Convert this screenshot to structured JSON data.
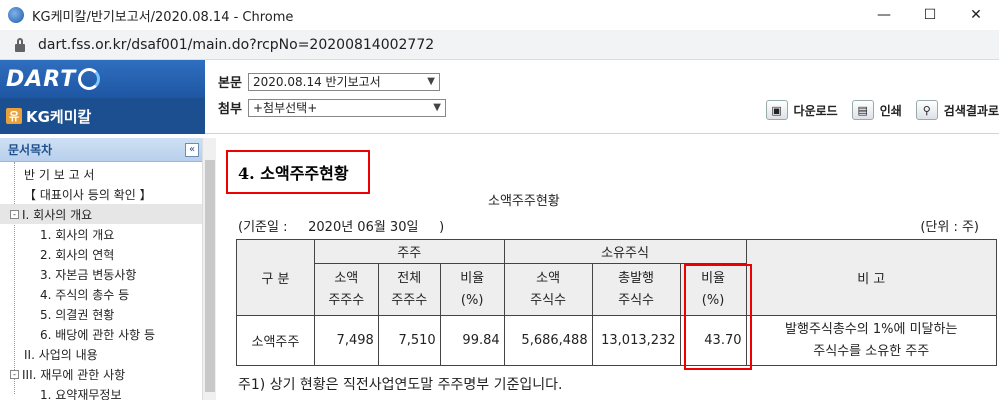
{
  "window": {
    "title": "KG케미칼/반기보고서/2020.08.14 - Chrome",
    "minimize": "—",
    "maximize": "☐",
    "close": "✕"
  },
  "address_bar": {
    "url": "dart.fss.or.kr/dsaf001/main.do?rcpNo=20200814002772"
  },
  "header": {
    "logo": "DART",
    "company": "KG케미칼",
    "company_badge": "유",
    "report_label": "본문",
    "report_value": "2020.08.14  반기보고서",
    "attach_label": "첨부",
    "attach_value": "+첨부선택+",
    "toolbar": {
      "download": "다운로드",
      "print": "인쇄",
      "search_results": "검색결과로"
    }
  },
  "sidebar": {
    "title": "문서목차",
    "collapse": "«",
    "items": [
      {
        "label": "반 기 보 고 서"
      },
      {
        "label": "【 대표이사 등의 확인 】"
      },
      {
        "label": "I. 회사의 개요",
        "expander": "-"
      },
      {
        "label": "1. 회사의 개요"
      },
      {
        "label": "2. 회사의 연혁"
      },
      {
        "label": "3. 자본금 변동사항"
      },
      {
        "label": "4. 주식의 총수 등"
      },
      {
        "label": "5. 의결권 현황"
      },
      {
        "label": "6. 배당에 관한 사항 등"
      },
      {
        "label": "II. 사업의 내용"
      },
      {
        "label": "III. 재무에 관한 사항",
        "expander": "-"
      },
      {
        "label": "1. 요약재무정보"
      }
    ]
  },
  "content": {
    "section_title": "4. 소액주주현황",
    "table_caption": "소액주주현황",
    "base_date": "(기준일 :     2020년 06월 30일     )",
    "unit": "(단위 : 주)",
    "table": {
      "col_gubun": "구 분",
      "group_shareholders": "주주",
      "group_shares": "소유주식",
      "col_note": "비 고",
      "sub_minor_holders": [
        "소액",
        "주주수"
      ],
      "sub_total_holders": [
        "전체",
        "주주수"
      ],
      "sub_ratio1": [
        "비율",
        "(%)"
      ],
      "sub_minor_shares": [
        "소액",
        "주식수"
      ],
      "sub_total_issued": [
        "총발행",
        "주식수"
      ],
      "sub_ratio2": [
        "비율",
        "(%)"
      ],
      "row": {
        "label": "소액주주",
        "minor_holders": "7,498",
        "total_holders": "7,510",
        "ratio1": "99.84",
        "minor_shares": "5,686,488",
        "total_issued": "13,013,232",
        "ratio2": "43.70",
        "note_line1": "발행주식총수의 1%에 미달하는",
        "note_line2": "주식수를 소유한 주주"
      }
    },
    "footnote": "주1) 상기 현황은 직전사업연도말 주주명부 기준입니다."
  }
}
